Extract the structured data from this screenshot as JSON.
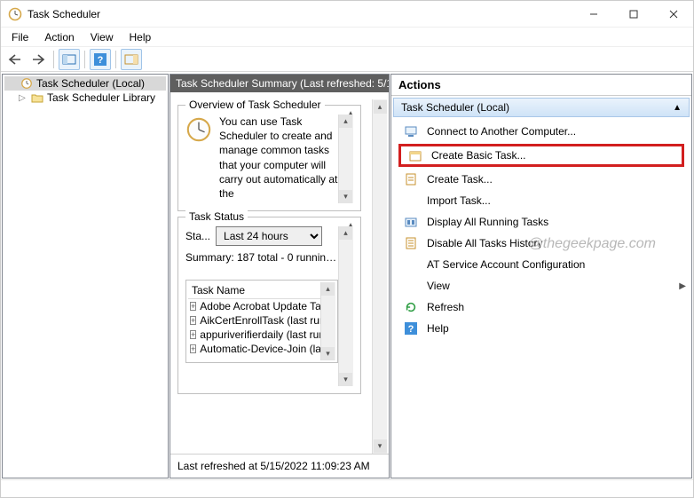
{
  "window": {
    "title": "Task Scheduler"
  },
  "menubar": {
    "file": "File",
    "action": "Action",
    "view": "View",
    "help": "Help"
  },
  "tree": {
    "root": "Task Scheduler (Local)",
    "child": "Task Scheduler Library"
  },
  "center": {
    "header": "Task Scheduler Summary (Last refreshed: 5/1",
    "overview_title": "Overview of Task Scheduler",
    "overview_text": "You can use Task Scheduler to create and manage common tasks that your computer will carry out automatically at the",
    "task_status_title": "Task Status",
    "status_label": "Sta...",
    "period_selected": "Last 24 hours",
    "summary": "Summary: 187 total - 0 running,...",
    "tasklist_header": "Task Name",
    "tasks": [
      "Adobe Acrobat Update Tas",
      "AikCertEnrollTask (last run",
      "appuriverifierdaily (last run",
      "Automatic-Device-Join (las"
    ],
    "statusbar": "Last refreshed at 5/15/2022 11:09:23 AM"
  },
  "actions": {
    "header": "Actions",
    "group": "Task Scheduler (Local)",
    "items": {
      "connect": "Connect to Another Computer...",
      "create_basic": "Create Basic Task...",
      "create_task": "Create Task...",
      "import_task": "Import Task...",
      "display_running": "Display All Running Tasks",
      "disable_history": "Disable All Tasks History",
      "at_service": "AT Service Account Configuration",
      "view": "View",
      "refresh": "Refresh",
      "help": "Help"
    }
  },
  "watermark": "@thegeekpage.com"
}
